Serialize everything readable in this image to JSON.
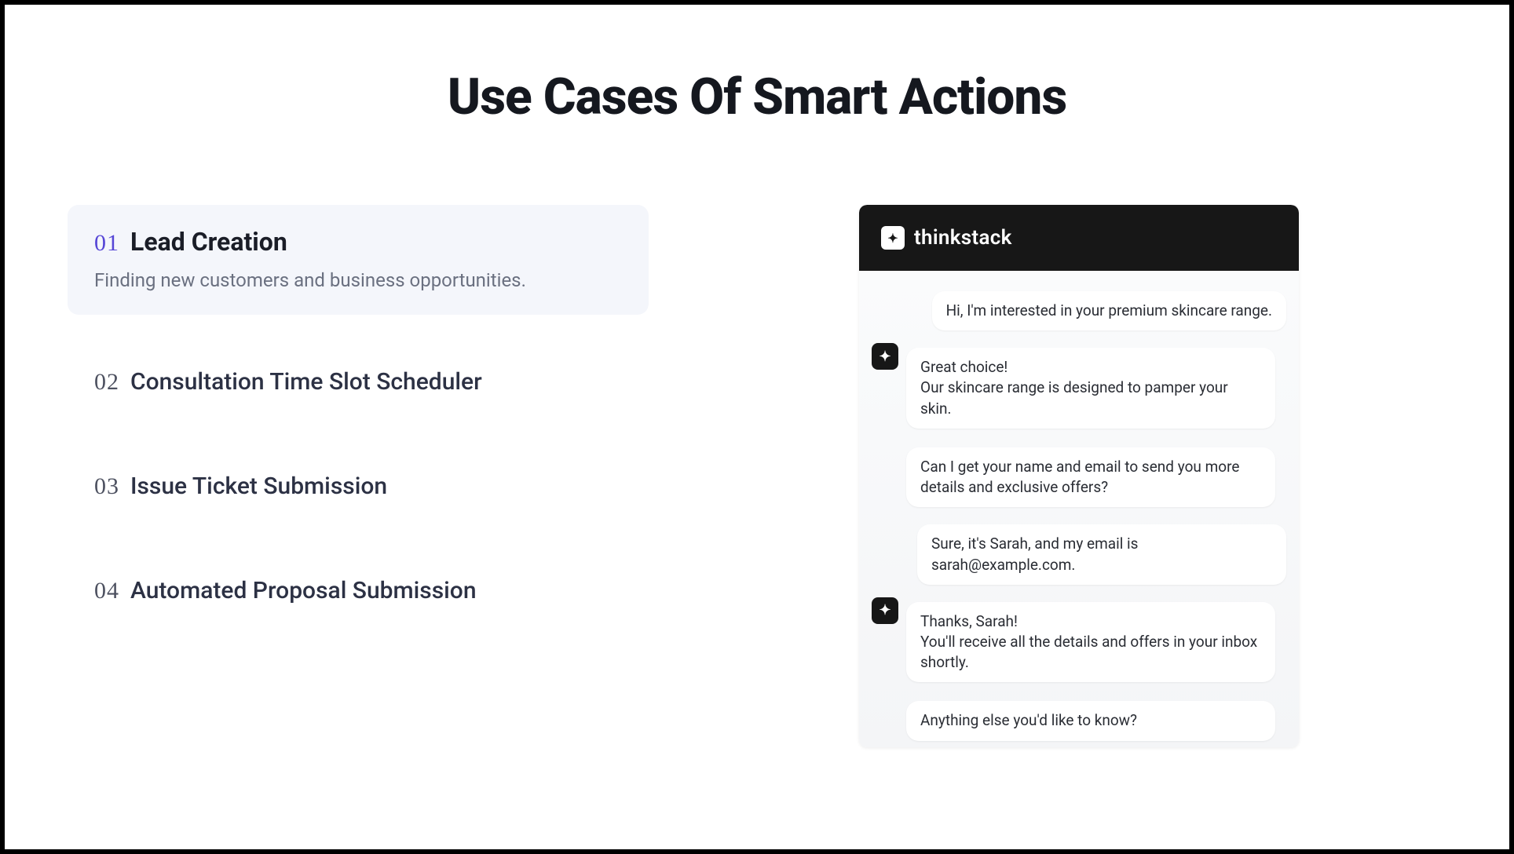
{
  "title": "Use Cases Of Smart Actions",
  "tabs": [
    {
      "num": "01",
      "title": "Lead Creation",
      "desc": "Finding new customers and business opportunities.",
      "active": true
    },
    {
      "num": "02",
      "title": "Consultation Time Slot Scheduler",
      "desc": "",
      "active": false
    },
    {
      "num": "03",
      "title": "Issue Ticket Submission",
      "desc": "",
      "active": false
    },
    {
      "num": "04",
      "title": "Automated Proposal Submission",
      "desc": "",
      "active": false
    }
  ],
  "chat": {
    "brand": "thinkstack",
    "logo_glyph": "✦",
    "messages": [
      {
        "from": "user",
        "lines": [
          "Hi, I'm interested in your premium skincare range."
        ]
      },
      {
        "from": "bot",
        "lines": [
          "Great choice!\nOur skincare range is designed to pamper your skin.",
          "Can I get your name and email to send you more details and exclusive offers?"
        ]
      },
      {
        "from": "user",
        "lines": [
          "Sure, it's Sarah, and my email is sarah@example.com."
        ]
      },
      {
        "from": "bot",
        "lines": [
          "Thanks, Sarah!\nYou'll receive all the details and offers in your inbox shortly.",
          "Anything else you'd like to know?"
        ]
      }
    ]
  }
}
